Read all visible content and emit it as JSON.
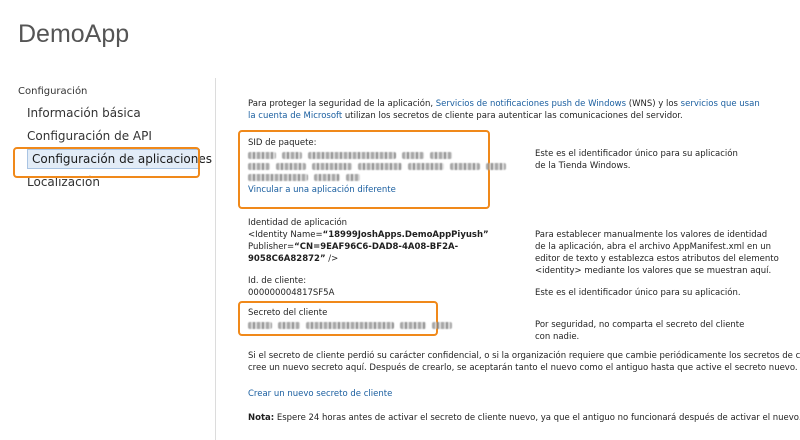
{
  "app": {
    "title": "DemoApp"
  },
  "sidebar": {
    "section_label": "Configuración",
    "items": [
      {
        "label": "Información básica"
      },
      {
        "label": "Configuración de API"
      },
      {
        "label": "Configuración de aplicaciones"
      },
      {
        "label": "Localización"
      }
    ]
  },
  "intro": {
    "text1": "Para proteger la seguridad de la aplicación, ",
    "link1": "Servicios de notificaciones push de Windows",
    "text2": " (WNS) y los ",
    "link2a": "servicios que usan",
    "link2b": "la cuenta de Microsoft",
    "text3": " utilizan los secretos de cliente para autenticar las comunicaciones del servidor."
  },
  "package_sid": {
    "label": "SID de paquete:",
    "link": "Vincular a una aplicación diferente",
    "desc_line1": "Este es el identificador único para su aplicación",
    "desc_line2": "de la Tienda Windows."
  },
  "app_identity": {
    "label": "Identidad de aplicación",
    "line1_prefix": "<Identity Name=",
    "line1_value": "“18999JoshApps.DemoAppPiyush”",
    "line2_prefix": "Publisher=",
    "line2_value": "“CN=9EAF96C6-DAD8-4A08-BF2A-",
    "line3_value": "9058C6A82872”",
    "line3_suffix": " />",
    "desc_line1": "Para establecer manualmente los valores de identidad",
    "desc_line2": "de la aplicación, abra el archivo AppManifest.xml en un",
    "desc_line3": "editor de texto y establezca estos atributos del elemento",
    "desc_line4": "<identity> mediante los valores que se muestran aquí."
  },
  "client_id": {
    "label": "Id. de cliente:",
    "value": "000000004817SF5A",
    "desc": "Este es el identificador único para su aplicación."
  },
  "client_secret": {
    "label": "Secreto del cliente",
    "desc_line1": "Por seguridad, no comparta el secreto del cliente",
    "desc_line2": "con nadie."
  },
  "secret_info": {
    "line1": "Si el secreto de cliente perdió su carácter confidencial, o si la organización requiere que cambie periódicamente los secretos de cliente,",
    "line2": "cree un nuevo secreto aquí. Después de crearlo, se aceptarán tanto el nuevo como el antiguo hasta que active el secreto nuevo."
  },
  "create_secret_link": "Crear un nuevo secreto de cliente",
  "note": {
    "label": "Nota:",
    "text": " Espere 24 horas antes de activar el secreto de cliente nuevo, ya que el antiguo no funcionará después de activar el nuevo."
  },
  "colors": {
    "highlight": "#f0891a",
    "link": "#1b5fa0",
    "active_bg": "#e2ecf7"
  }
}
